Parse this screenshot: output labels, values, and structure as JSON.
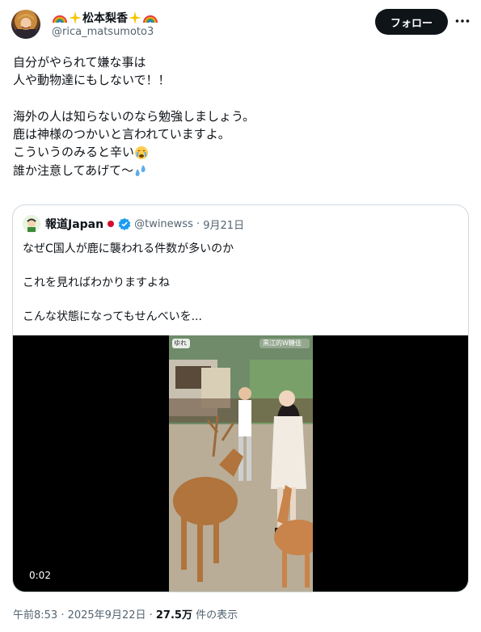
{
  "author": {
    "name": "松本梨香",
    "handle": "@rica_matsumoto3"
  },
  "follow_label": "フォロー",
  "more_icon": "more-horizontal-icon",
  "tweet_lines": [
    "自分がやられて嫌な事は",
    "人や動物達にもしないで！！",
    "",
    "海外の人は知らないのなら勉強しましょう。",
    "鹿は神様のつかいと言われていますよ。",
    "こういうのみると辛い",
    "誰か注意してあげて〜"
  ],
  "quote": {
    "name": "報道Japan",
    "handle": "@twinewss",
    "date": "9月21日",
    "lines": [
      "なぜC国人が鹿に襲われる件数が多いのか",
      "",
      "これを見ればわかりますよね",
      "",
      "こんな状態になってもせんべいを..."
    ],
    "video_time": "0:02",
    "video_overlay_left": "ゆれ",
    "video_overlay_right": "黒江的W糖佳"
  },
  "footer": {
    "time": "午前8:53 · 2025年9月22日 · ",
    "views": "27.5万",
    "views_suffix": " 件の表示"
  },
  "colors": {
    "text": "#0f1419",
    "secondary": "#536471",
    "border": "#cfd9de",
    "verified": "#1d9bf0",
    "follow_bg": "#0f1419"
  }
}
